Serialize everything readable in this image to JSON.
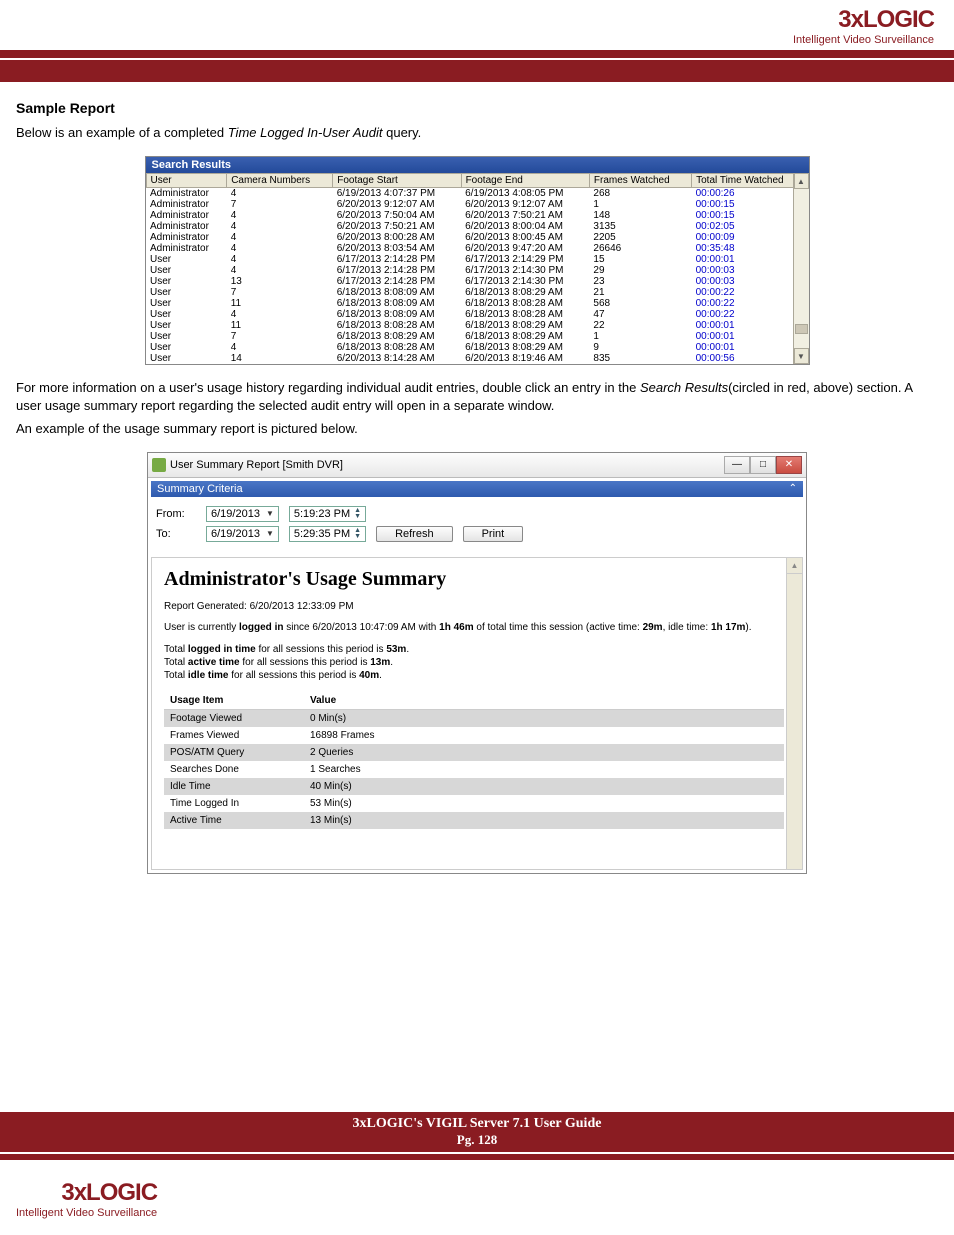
{
  "header_logo": {
    "main": "3xLOGIC",
    "sub": "Intelligent Video Surveillance"
  },
  "section_title": "Sample Report",
  "intro_pre": "Below is an example of a completed ",
  "intro_em": "Time Logged In-User Audit",
  "intro_post": " query.",
  "search_results": {
    "title": "Search Results",
    "cols": [
      "User",
      "Camera Numbers",
      "Footage Start",
      "Footage End",
      "Frames Watched",
      "Total Time Watched"
    ],
    "rows": [
      [
        "Administrator",
        "4",
        "6/19/2013 4:07:37 PM",
        "6/19/2013 4:08:05 PM",
        "268",
        "00:00:26"
      ],
      [
        "Administrator",
        "7",
        "6/20/2013 9:12:07 AM",
        "6/20/2013 9:12:07 AM",
        "1",
        "00:00:15"
      ],
      [
        "Administrator",
        "4",
        "6/20/2013 7:50:04 AM",
        "6/20/2013 7:50:21 AM",
        "148",
        "00:00:15"
      ],
      [
        "Administrator",
        "4",
        "6/20/2013 7:50:21 AM",
        "6/20/2013 8:00:04 AM",
        "3135",
        "00:02:05"
      ],
      [
        "Administrator",
        "4",
        "6/20/2013 8:00:28 AM",
        "6/20/2013 8:00:45 AM",
        "2205",
        "00:00:09"
      ],
      [
        "Administrator",
        "4",
        "6/20/2013 8:03:54 AM",
        "6/20/2013 9:47:20 AM",
        "26646",
        "00:35:48"
      ],
      [
        "User",
        "4",
        "6/17/2013 2:14:28 PM",
        "6/17/2013 2:14:29 PM",
        "15",
        "00:00:01"
      ],
      [
        "User",
        "4",
        "6/17/2013 2:14:28 PM",
        "6/17/2013 2:14:30 PM",
        "29",
        "00:00:03"
      ],
      [
        "User",
        "13",
        "6/17/2013 2:14:28 PM",
        "6/17/2013 2:14:30 PM",
        "23",
        "00:00:03"
      ],
      [
        "User",
        "7",
        "6/18/2013 8:08:09 AM",
        "6/18/2013 8:08:29 AM",
        "21",
        "00:00:22"
      ],
      [
        "User",
        "11",
        "6/18/2013 8:08:09 AM",
        "6/18/2013 8:08:28 AM",
        "568",
        "00:00:22"
      ],
      [
        "User",
        "4",
        "6/18/2013 8:08:09 AM",
        "6/18/2013 8:08:28 AM",
        "47",
        "00:00:22"
      ],
      [
        "User",
        "11",
        "6/18/2013 8:08:28 AM",
        "6/18/2013 8:08:29 AM",
        "22",
        "00:00:01"
      ],
      [
        "User",
        "7",
        "6/18/2013 8:08:29 AM",
        "6/18/2013 8:08:29 AM",
        "1",
        "00:00:01"
      ],
      [
        "User",
        "4",
        "6/18/2013 8:08:28 AM",
        "6/18/2013 8:08:29 AM",
        "9",
        "00:00:01"
      ],
      [
        "User",
        "14",
        "6/20/2013 8:14:28 AM",
        "6/20/2013 8:19:46 AM",
        "835",
        "00:00:56"
      ]
    ]
  },
  "mid1_pre": "For more information on a user's usage history regarding individual audit entries, double click an entry in the ",
  "mid1_em": "Search Results",
  "mid1_post": "(circled in red, above) section. A user usage summary report regarding the selected audit entry will open in a separate window.",
  "mid2": "An example of the usage summary report is pictured below.",
  "summary_window": {
    "title": "User Summary Report [Smith DVR]",
    "criteria_label": "Summary Criteria",
    "from_label": "From:",
    "to_label": "To:",
    "from_date": "6/19/2013",
    "from_time": "5:19:23 PM",
    "to_date": "6/19/2013",
    "to_time": "5:29:35 PM",
    "refresh": "Refresh",
    "print": "Print",
    "rep_title": "Administrator's Usage Summary",
    "rep_gen": "Report Generated: 6/20/2013 12:33:09 PM",
    "rep_status_1": "User is currently ",
    "rep_status_b1": "logged in",
    "rep_status_2": " since 6/20/2013 10:47:09 AM with ",
    "rep_status_b2": "1h 46m",
    "rep_status_3": " of total time this session (active time: ",
    "rep_status_b3": "29m",
    "rep_status_4": ", idle time: ",
    "rep_status_b4": "1h 17m",
    "rep_status_5": ").",
    "tot1a": "Total ",
    "tot1b": "logged in time",
    "tot1c": " for all sessions this period is ",
    "tot1d": "53m",
    "tot1e": ".",
    "tot2a": "Total ",
    "tot2b": "active time",
    "tot2c": " for all sessions this period is ",
    "tot2d": "13m",
    "tot2e": ".",
    "tot3a": "Total ",
    "tot3b": "idle time",
    "tot3c": " for all sessions this period is ",
    "tot3d": "40m",
    "tot3e": ".",
    "us_cols": [
      "Usage Item",
      "Value"
    ],
    "us_rows": [
      [
        "Footage Viewed",
        "0 Min(s)"
      ],
      [
        "Frames Viewed",
        "16898 Frames"
      ],
      [
        "POS/ATM Query",
        "2 Queries"
      ],
      [
        "Searches Done",
        "1 Searches"
      ],
      [
        "Idle Time",
        "40 Min(s)"
      ],
      [
        "Time Logged In",
        "53 Min(s)"
      ],
      [
        "Active Time",
        "13 Min(s)"
      ]
    ]
  },
  "footer": {
    "title": "3xLOGIC's VIGIL Server 7.1 User Guide",
    "page": "Pg. 128"
  }
}
